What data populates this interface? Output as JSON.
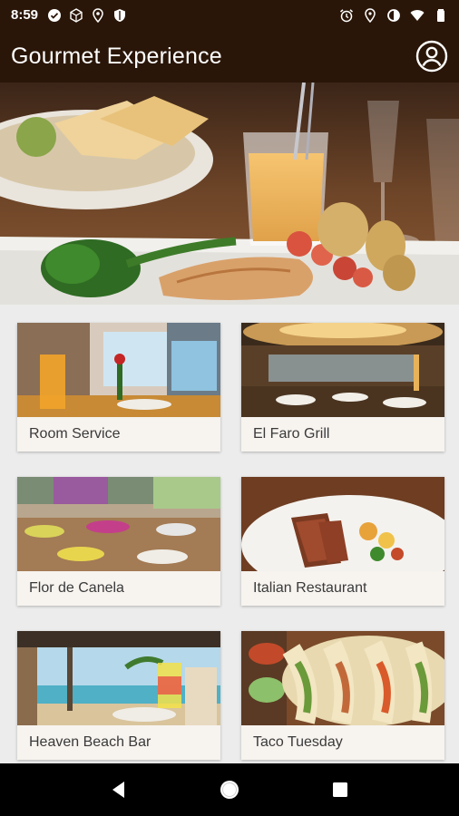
{
  "status_bar": {
    "time": "8:59",
    "left_icons": [
      "check-circle-icon",
      "cube-icon",
      "location-pin-icon",
      "shield-icon"
    ],
    "right_icons": [
      "alarm-icon",
      "location-icon",
      "data-saver-icon",
      "wifi-icon",
      "battery-icon"
    ]
  },
  "app_bar": {
    "title": "Gourmet Experience",
    "account_icon": "account-circle-icon"
  },
  "hero": {
    "image": "plated-food-hero-image"
  },
  "restaurants": [
    {
      "label": "Room Service"
    },
    {
      "label": "El Faro Grill"
    },
    {
      "label": "Flor de Canela"
    },
    {
      "label": "Italian Restaurant"
    },
    {
      "label": "Heaven Beach Bar"
    },
    {
      "label": "Taco Tuesday"
    }
  ],
  "nav_bar": {
    "icons": [
      "back-triangle-icon",
      "home-circle-icon",
      "recents-square-icon"
    ]
  },
  "colors": {
    "app_bar": "#2a1608",
    "card_background": "#f7f3ef",
    "page_background": "#ececec"
  }
}
